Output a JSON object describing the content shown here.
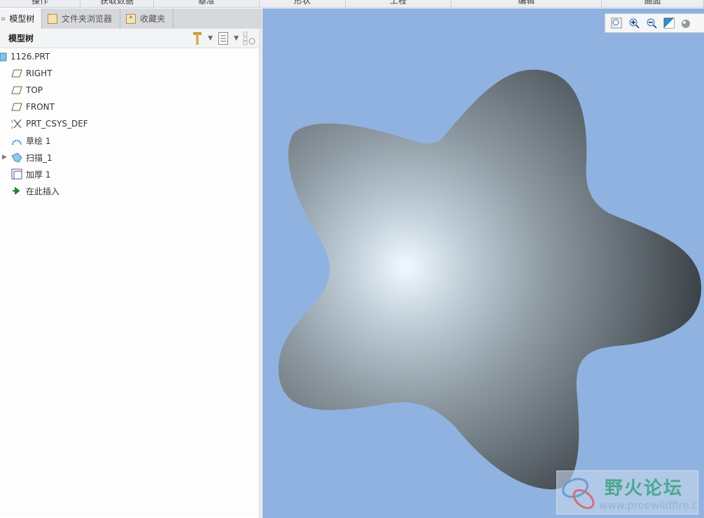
{
  "ribbon": {
    "groups": [
      "操作",
      "获取数据",
      "基准",
      "形状",
      "工程",
      "编辑",
      "曲面"
    ]
  },
  "panel": {
    "tabs": [
      {
        "label": "模型树",
        "icon": "model-tree-icon"
      },
      {
        "label": "文件夹浏览器",
        "icon": "folder-icon"
      },
      {
        "label": "收藏夹",
        "icon": "favorites-icon"
      }
    ],
    "header": "模型树",
    "tree": [
      {
        "label": "1126.PRT",
        "icon": "part-icon"
      },
      {
        "label": "RIGHT",
        "icon": "datum-plane-icon"
      },
      {
        "label": "TOP",
        "icon": "datum-plane-icon"
      },
      {
        "label": "FRONT",
        "icon": "datum-plane-icon"
      },
      {
        "label": "PRT_CSYS_DEF",
        "icon": "csys-icon"
      },
      {
        "label": "草绘 1",
        "icon": "sketch-icon"
      },
      {
        "label": "扫描_1",
        "icon": "sweep-icon",
        "expandable": true
      },
      {
        "label": "加厚 1",
        "icon": "thicken-icon"
      },
      {
        "label": "在此插入",
        "icon": "insert-here-arrow-icon"
      }
    ]
  },
  "viewport": {
    "background": "#8fb2e0",
    "toolbar": [
      "refit-icon",
      "zoom-in-icon",
      "zoom-out-icon",
      "repaint-icon",
      "display-style-icon"
    ]
  },
  "watermark": {
    "title": "野火论坛",
    "url": "www.proewildfire.cn"
  }
}
